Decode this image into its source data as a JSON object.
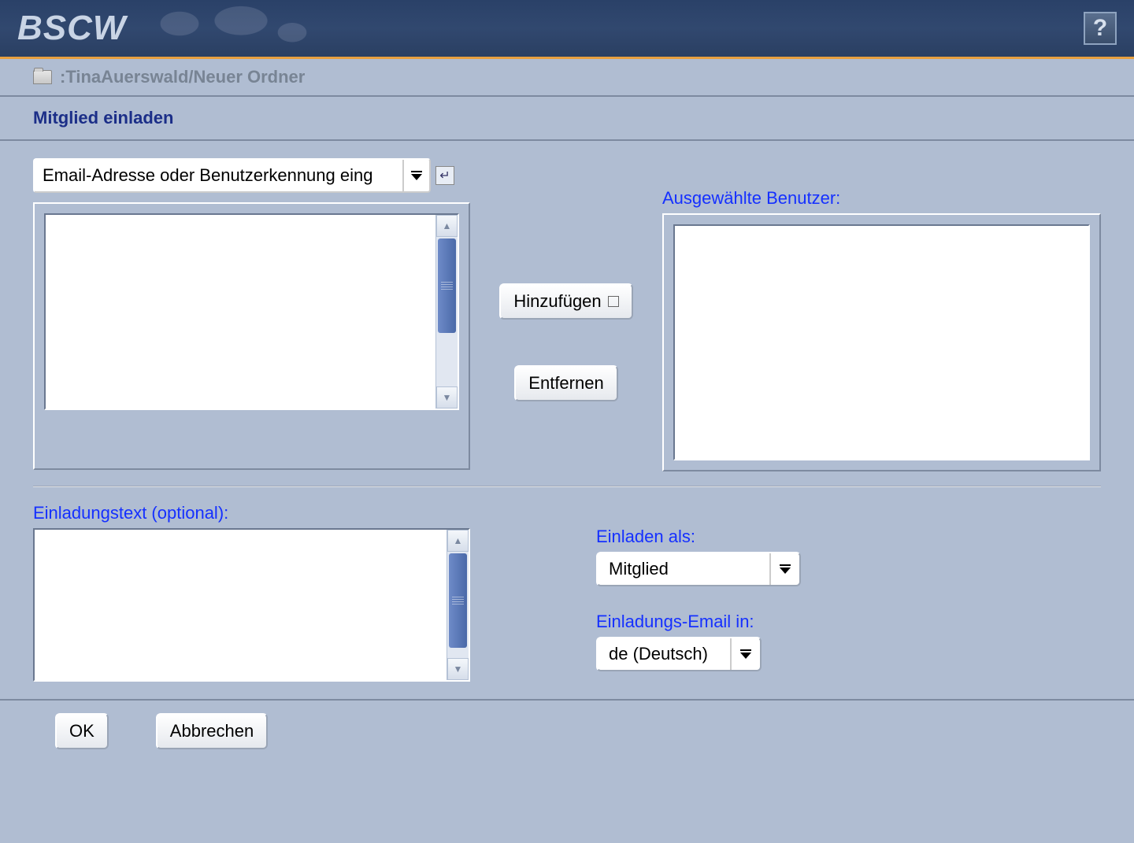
{
  "header": {
    "logo": "BSCW",
    "help_label": "?"
  },
  "breadcrumb": {
    "path": ":TinaAuerswald/Neuer Ordner"
  },
  "title": "Mitglied einladen",
  "search": {
    "value": "Email-Adresse oder Benutzerkennung eing"
  },
  "actions": {
    "add_label": "Hinzufügen",
    "remove_label": "Entfernen"
  },
  "labels": {
    "selected_users": "Ausgewählte Benutzer:",
    "invitation_text": "Einladungstext (optional):",
    "invite_as": "Einladen als:",
    "invitation_email_in": "Einladungs-Email in:"
  },
  "invite_as": {
    "selected": "Mitglied"
  },
  "language": {
    "selected": "de (Deutsch)"
  },
  "footer": {
    "ok_label": "OK",
    "cancel_label": "Abbrechen"
  }
}
